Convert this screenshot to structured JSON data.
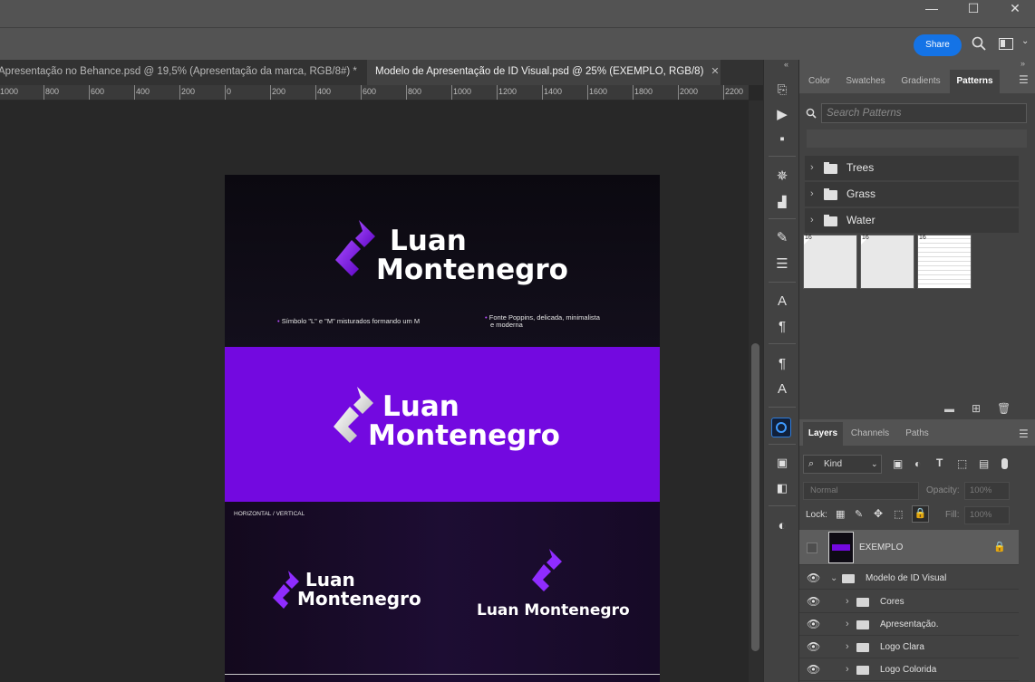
{
  "window": {
    "minimize": "—",
    "maximize": "☐",
    "close": "✕"
  },
  "options_bar": {
    "share_label": "Share",
    "search_icon": "search-icon",
    "workspace_icon": "workspace-icon"
  },
  "doc_tabs": [
    {
      "label": "Apresentação no Behance.psd @ 19,5% (Apresentação da marca, RGB/8#) *",
      "active": false
    },
    {
      "label": "Modelo de Apresentação de ID Visual.psd @ 25% (EXEMPLO, RGB/8)",
      "active": true
    }
  ],
  "ruler": {
    "labels": [
      "1000",
      "800",
      "600",
      "400",
      "200",
      "0",
      "200",
      "400",
      "600",
      "800",
      "1000",
      "1200",
      "1400",
      "1600",
      "1800",
      "2000",
      "2200"
    ]
  },
  "artboard": {
    "logo_line1": "Luan",
    "logo_line2": "Montenegro",
    "note_left": "Símbolo \"L\" e \"M\" misturados formando um M",
    "note_right_1": "Fonte Poppins, delicada, minimalista",
    "note_right_2": "e moderna",
    "layout_label": "HORIZONTAL / VERTICAL",
    "vertical_logo": "Luan Montenegro",
    "colors": {
      "dark": "#0e0b14",
      "purple": "#7309e0",
      "accent": "#8f2cff"
    }
  },
  "patterns_panel": {
    "tabs": [
      "Color",
      "Swatches",
      "Gradients",
      "Patterns"
    ],
    "active_tab": "Patterns",
    "search_placeholder": "Search Patterns",
    "folders": [
      "Trees",
      "Grass",
      "Water"
    ],
    "swatch_badge": "16"
  },
  "layers_panel": {
    "tabs": [
      "Layers",
      "Channels",
      "Paths"
    ],
    "active_tab": "Layers",
    "kind_label": "Kind",
    "blend_mode": "Normal",
    "opacity_label": "Opacity:",
    "opacity_value": "100%",
    "lock_label": "Lock:",
    "fill_label": "Fill:",
    "fill_value": "100%",
    "layers": [
      {
        "name": "EXEMPLO",
        "type": "artboard",
        "visible": false,
        "locked": true
      },
      {
        "name": "Modelo de ID Visual",
        "type": "group",
        "expanded": true,
        "visible": true
      },
      {
        "name": "Cores",
        "type": "group",
        "visible": true
      },
      {
        "name": "Apresentação.",
        "type": "group",
        "visible": true
      },
      {
        "name": "Logo Clara",
        "type": "group",
        "visible": true
      },
      {
        "name": "Logo Colorida",
        "type": "group",
        "visible": true
      }
    ]
  }
}
